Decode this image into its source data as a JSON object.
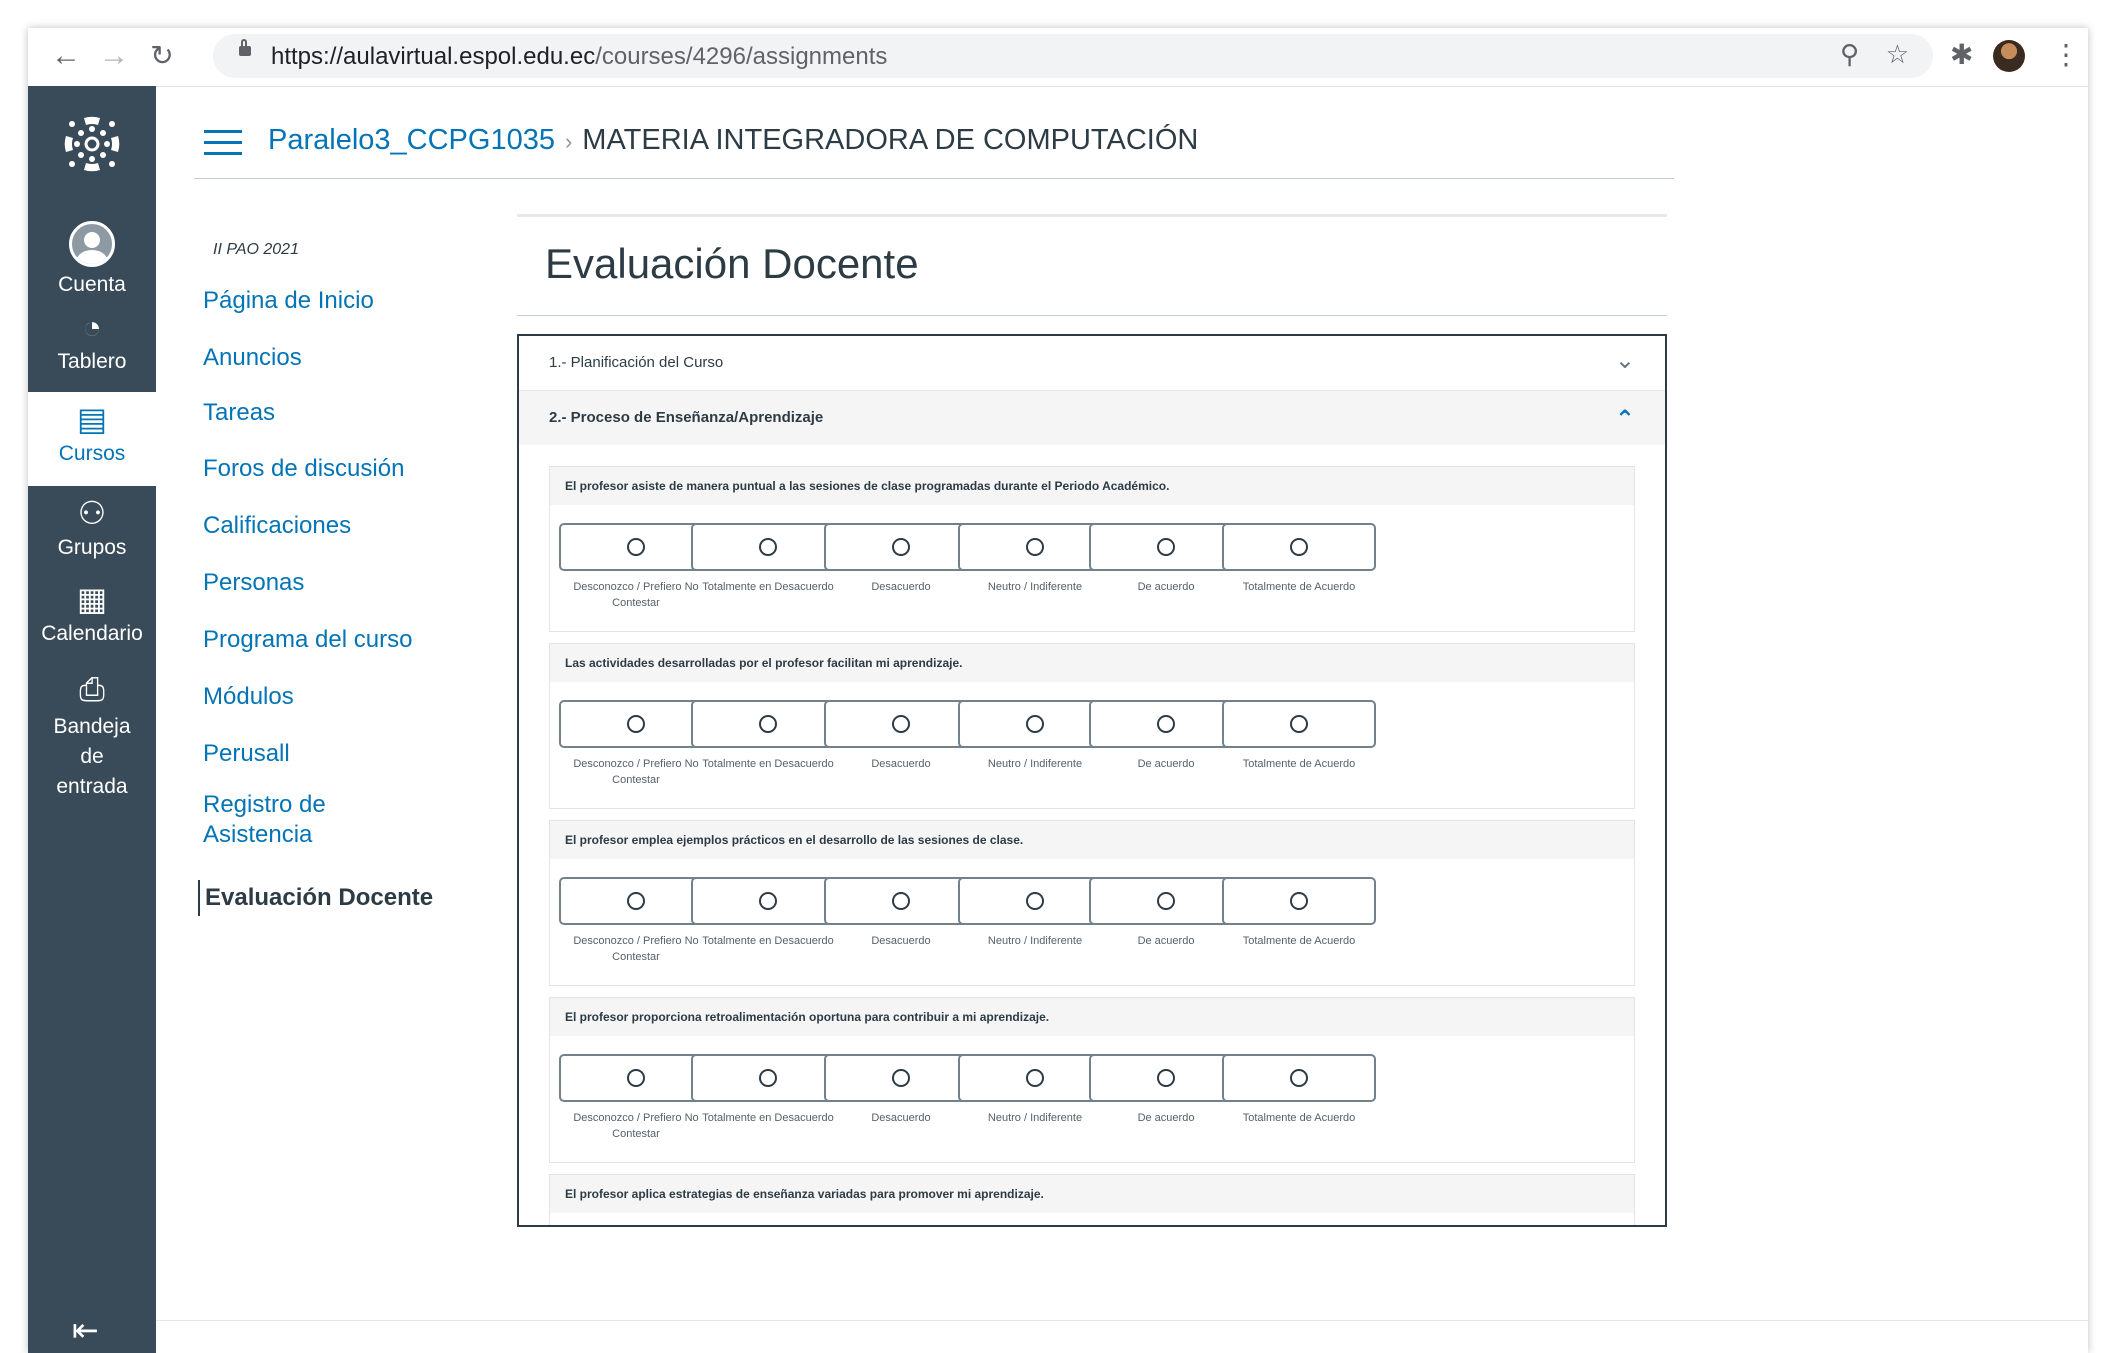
{
  "browser": {
    "url_host": "https://aulavirtual.espol.edu.ec",
    "url_path": "/courses/4296/assignments"
  },
  "global_nav": {
    "items": [
      {
        "label": "Cuenta",
        "icon": "account-icon"
      },
      {
        "label": "Tablero",
        "icon": "dashboard-icon"
      },
      {
        "label": "Cursos",
        "icon": "courses-icon",
        "active": true
      },
      {
        "label": "Grupos",
        "icon": "groups-icon"
      },
      {
        "label": "Calendario",
        "icon": "calendar-icon"
      },
      {
        "label": "Bandeja de entrada",
        "icon": "inbox-icon"
      }
    ]
  },
  "breadcrumb": {
    "course": "Paralelo3_CCPG1035",
    "separator": "›",
    "page": "MATERIA INTEGRADORA DE COMPUTACIÓN"
  },
  "course_nav": {
    "term": "II PAO 2021",
    "items": [
      "Página de Inicio",
      "Anuncios",
      "Tareas",
      "Foros de discusión",
      "Calificaciones",
      "Personas",
      "Programa del curso",
      "Módulos",
      "Perusall",
      "Registro de Asistencia",
      "Evaluación Docente"
    ],
    "active": "Evaluación Docente"
  },
  "page_title": "Evaluación Docente",
  "survey": {
    "sections": [
      {
        "label": "1.- Planificación del Curso",
        "expanded": false
      },
      {
        "label": "2.- Proceso de Enseñanza/Aprendizaje",
        "expanded": true
      }
    ],
    "options": [
      "Desconozco / Prefiero No Contestar",
      "Totalmente en Desacuerdo",
      "Desacuerdo",
      "Neutro / Indiferente",
      "De acuerdo",
      "Totalmente de Acuerdo"
    ],
    "questions": [
      "El profesor asiste de manera puntual a las sesiones de clase programadas durante el Periodo Académico.",
      "Las actividades desarrolladas por el profesor facilitan mi aprendizaje.",
      "El profesor emplea ejemplos prácticos en el desarrollo de las sesiones de clase.",
      "El profesor proporciona retroalimentación oportuna para contribuir a mi aprendizaje.",
      "El profesor aplica estrategias de enseñanza variadas para promover mi aprendizaje."
    ]
  },
  "colors": {
    "nav_bg": "#394b58",
    "link": "#0374b5",
    "text": "#2d3b45"
  }
}
